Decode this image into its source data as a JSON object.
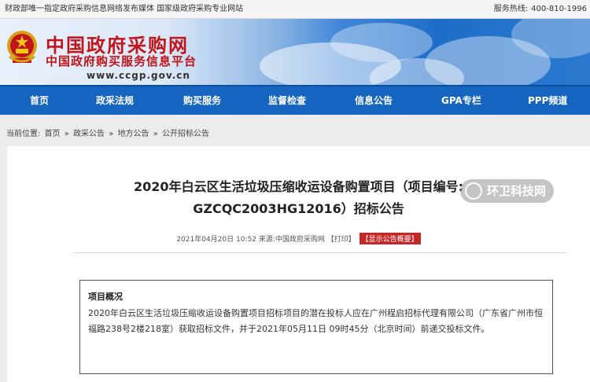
{
  "topbar": {
    "left_text": "财政部唯一指定政府采购信息网络发布媒体 国家级政府采购专业网站",
    "hotline_label": "服务热线:",
    "hotline_number": "400-810-1996"
  },
  "header": {
    "brand_primary": "中国政府采购网",
    "brand_secondary": "中国政府购买服务信息平台",
    "url": "www.ccgp.gov.cn",
    "emblem_icon": "national-emblem-icon"
  },
  "nav": {
    "items": [
      {
        "label": "首页"
      },
      {
        "label": "政采法规"
      },
      {
        "label": "购买服务"
      },
      {
        "label": "监督检查"
      },
      {
        "label": "信息公告"
      },
      {
        "label": "GPA专栏"
      },
      {
        "label": "PPP频道"
      }
    ]
  },
  "breadcrumb": {
    "prefix": "当前位置:",
    "items": [
      "首页",
      "政采公告",
      "地方公告",
      "公开招标公告"
    ],
    "separator": "»"
  },
  "article": {
    "title_line1": "2020年白云区生活垃圾压缩收运设备购置项目（项目编号:",
    "title_line2": "GZCQC2003HG12016）招标公告",
    "date": "2021年04月20日 10:52",
    "source_label": "来源:",
    "source": "中国政府采购网",
    "print_link": "【打印】",
    "summary_button": "【显示公告概要】"
  },
  "overview": {
    "heading": "项目概况",
    "body": "2020年白云区生活垃圾压缩收运设备购置项目招标项目的潜在投标人应在广州程启招标代理有限公司（广东省广州市恒福路238号2楼218室）获取招标文件，并于2021年05月11日 09时45分（北京时间）前递交投标文件。"
  },
  "watermark": {
    "text": "环卫科技网"
  },
  "colors": {
    "nav_bg": "#1565c0",
    "brand_red": "#c0151a",
    "summary_button_bg": "#c62828"
  }
}
